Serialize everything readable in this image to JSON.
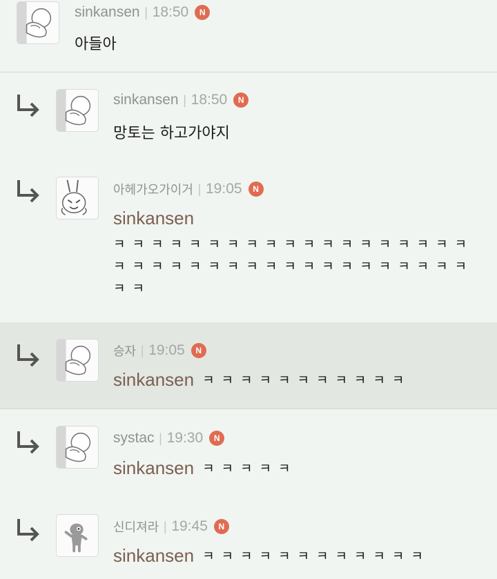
{
  "comments": [
    {
      "author": "sinkansen",
      "time": "18:50",
      "badge": "N",
      "avatar_icon": "emoticon-face-icon",
      "text": "아들아"
    },
    {
      "author": "sinkansen",
      "time": "18:50",
      "badge": "N",
      "avatar_icon": "emoticon-face-icon",
      "text": "망토는 하고가야지"
    },
    {
      "author": "아헤가오가이거",
      "time": "19:05",
      "badge": "N",
      "avatar_icon": "rabbit-emoticon-icon",
      "mention": "sinkansen",
      "line1": "ㅋㅋㅋㅋㅋㅋㅋㅋㅋㅋㅋㅋㅋㅋㅋㅋㅋㅋㅋ",
      "line2": "ㅋㅋㅋㅋㅋㅋㅋㅋㅋㅋㅋㅋㅋㅋㅋㅋㅋㅋㅋ",
      "line3": "ㅋㅋ"
    },
    {
      "author": "승자",
      "time": "19:05",
      "badge": "N",
      "avatar_icon": "emoticon-face-icon",
      "mention": "sinkansen",
      "text": "ㅋㅋㅋㅋㅋㅋㅋㅋㅋㅋㅋ"
    },
    {
      "author": "systac",
      "time": "19:30",
      "badge": "N",
      "avatar_icon": "emoticon-face-icon",
      "mention": "sinkansen",
      "text": "ㅋㅋㅋㅋㅋ"
    },
    {
      "author": "신디져라",
      "time": "19:45",
      "badge": "N",
      "avatar_icon": "creature-figure-icon",
      "mention": "sinkansen",
      "text": "ㅋㅋㅋㅋㅋㅋㅋㅋㅋㅋㅋㅋ"
    }
  ],
  "colors": {
    "background": "#f1f5f1",
    "highlight_row": "#e3e7e2",
    "mention": "#7b5f52",
    "new_badge": "#df6c52"
  }
}
